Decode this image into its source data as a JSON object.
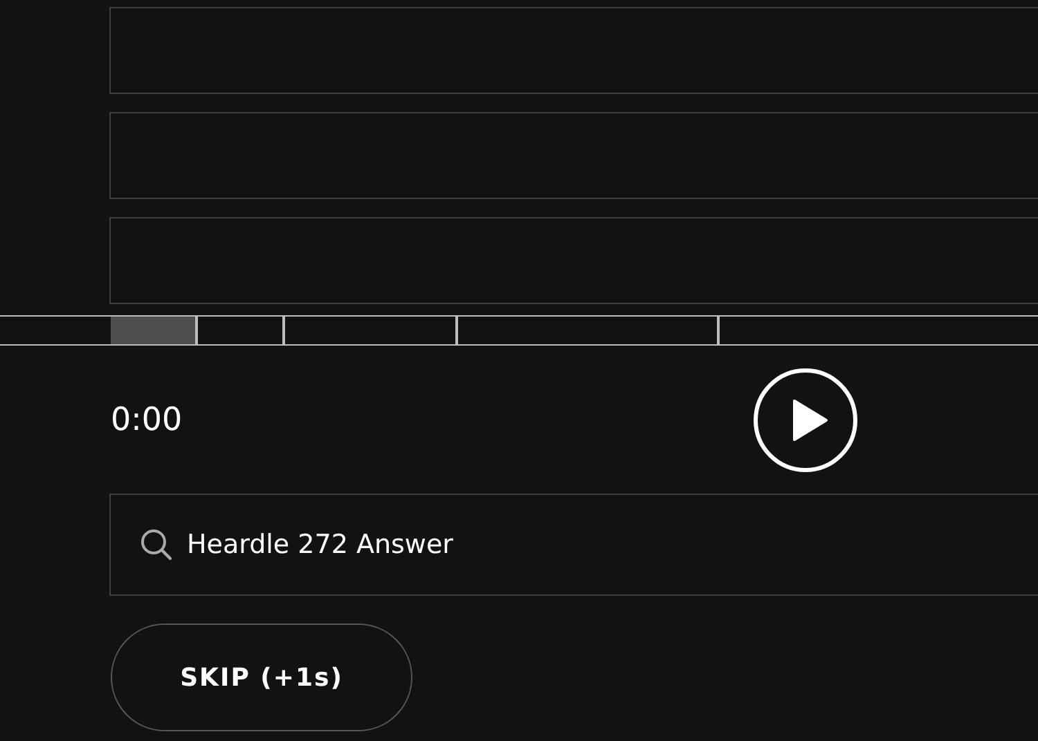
{
  "guesses": [
    {
      "kind": "empty"
    },
    {
      "kind": "empty"
    },
    {
      "kind": "empty"
    }
  ],
  "timeline": {
    "segments": [
      {
        "played": true
      },
      {
        "played": false
      },
      {
        "played": false
      },
      {
        "played": false
      },
      {
        "played": false
      }
    ]
  },
  "player": {
    "time": "0:00",
    "playing": false
  },
  "search": {
    "value": "Heardle 272 Answer"
  },
  "skip_button": {
    "label": "SKIP (+1s)"
  }
}
